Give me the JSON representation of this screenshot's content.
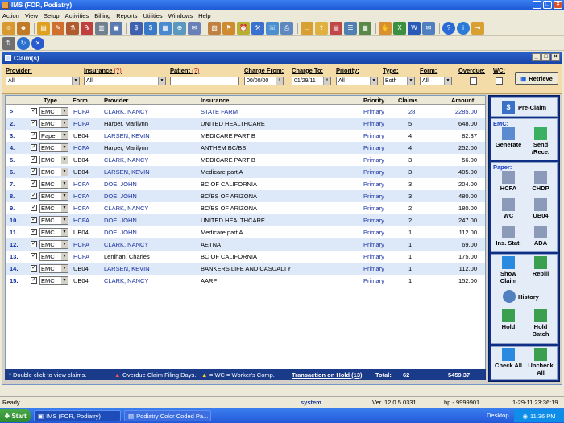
{
  "window": {
    "title": "IMS (FOR, Podiatry)"
  },
  "menu": [
    "Action",
    "View",
    "Setup",
    "Activities",
    "Billing",
    "Reports",
    "Utilities",
    "Windows",
    "Help"
  ],
  "child": {
    "title": "Claim(s)"
  },
  "filters": {
    "provider_label": "Provider:",
    "provider_value": "All",
    "insurance_label": "Insurance",
    "insurance_q": "(?)",
    "insurance_value": "All",
    "patient_label": "Patient",
    "patient_q": "(?)",
    "patient_value": "",
    "charge_from_label": "Charge From:",
    "charge_from_value": "00/00/00",
    "charge_to_label": "Charge To:",
    "charge_to_value": "01/29/11",
    "priority_label": "Priority:",
    "priority_value": "All",
    "type_label": "Type:",
    "type_value": "Both",
    "form_label": "Form:",
    "form_value": "All",
    "overdue_label": "Overdue:",
    "wc_label": "WC:",
    "retrieve_label": "Retrieve"
  },
  "grid": {
    "headers": {
      "type": "Type",
      "form": "Form",
      "provider": "Provider",
      "insurance": "Insurance",
      "priority": "Priority",
      "claims": "Claims",
      "amount": "Amount"
    },
    "rows": [
      {
        "num": ">",
        "type": "EMC",
        "form": "HCFA",
        "provider": "CLARK, NANCY",
        "insurance": "STATE FARM",
        "priority": "Primary",
        "claims": "28",
        "amount": "2285.00"
      },
      {
        "num": "2.",
        "type": "EMC",
        "form": "HCFA",
        "provider": "Harper, Marilynn",
        "insurance": "UNITED HEALTHCARE",
        "priority": "Primary",
        "claims": "5",
        "amount": "648.00"
      },
      {
        "num": "3.",
        "type": "Paper",
        "form": "UB04",
        "provider": "LARSEN, KEVIN",
        "insurance": "MEDICARE PART B",
        "priority": "Primary",
        "claims": "4",
        "amount": "82.37"
      },
      {
        "num": "4.",
        "type": "EMC",
        "form": "HCFA",
        "provider": "Harper, Marilynn",
        "insurance": "ANTHEM BC/BS",
        "priority": "Primary",
        "claims": "4",
        "amount": "252.00"
      },
      {
        "num": "5.",
        "type": "EMC",
        "form": "UB04",
        "provider": "CLARK, NANCY",
        "insurance": "MEDICARE PART B",
        "priority": "Primary",
        "claims": "3",
        "amount": "56.00"
      },
      {
        "num": "6.",
        "type": "EMC",
        "form": "UB04",
        "provider": "LARSEN, KEVIN",
        "insurance": "Medicare part A",
        "priority": "Primary",
        "claims": "3",
        "amount": "405.00"
      },
      {
        "num": "7.",
        "type": "EMC",
        "form": "HCFA",
        "provider": "DOE, JOHN",
        "insurance": "BC OF CALIFORNIA",
        "priority": "Primary",
        "claims": "3",
        "amount": "204.00"
      },
      {
        "num": "8.",
        "type": "EMC",
        "form": "HCFA",
        "provider": "DOE, JOHN",
        "insurance": "BC/BS OF ARIZONA",
        "priority": "Primary",
        "claims": "3",
        "amount": "480.00"
      },
      {
        "num": "9.",
        "type": "EMC",
        "form": "HCFA",
        "provider": "CLARK, NANCY",
        "insurance": "BC/BS OF ARIZONA",
        "priority": "Primary",
        "claims": "2",
        "amount": "180.00"
      },
      {
        "num": "10.",
        "type": "EMC",
        "form": "HCFA",
        "provider": "DOE, JOHN",
        "insurance": "UNITED HEALTHCARE",
        "priority": "Primary",
        "claims": "2",
        "amount": "247.00"
      },
      {
        "num": "11.",
        "type": "EMC",
        "form": "UB04",
        "provider": "DOE, JOHN",
        "insurance": "Medicare part A",
        "priority": "Primary",
        "claims": "1",
        "amount": "112.00"
      },
      {
        "num": "12.",
        "type": "EMC",
        "form": "HCFA",
        "provider": "CLARK, NANCY",
        "insurance": "AETNA",
        "priority": "Primary",
        "claims": "1",
        "amount": "69.00"
      },
      {
        "num": "13.",
        "type": "EMC",
        "form": "HCFA",
        "provider": "Lenihan, Charles",
        "insurance": "BC OF CALIFORNIA",
        "priority": "Primary",
        "claims": "1",
        "amount": "175.00"
      },
      {
        "num": "14.",
        "type": "EMC",
        "form": "UB04",
        "provider": "LARSEN, KEVIN",
        "insurance": "BANKERS LIFE AND CASUALTY",
        "priority": "Primary",
        "claims": "1",
        "amount": "112.00"
      },
      {
        "num": "15.",
        "type": "EMC",
        "form": "UB04",
        "provider": "CLARK, NANCY",
        "insurance": "AARP",
        "priority": "Primary",
        "claims": "1",
        "amount": "152.00"
      }
    ]
  },
  "footer": {
    "hint": "* Double click  to view claims.",
    "overdue": "Overdue Claim Filing Days.",
    "wc": "= WC = Worker's Comp.",
    "hold": "Transaction on Hold (13)",
    "total_label": "Total:",
    "total_claims": "62",
    "total_amount": "5459.37"
  },
  "side": {
    "preclaim": "Pre-Claim",
    "emc_label": "EMC:",
    "generate": "Generate",
    "send": "Send /Rece.",
    "paper_label": "Paper:",
    "hcfa": "HCFA",
    "chdp": "CHDP",
    "wc": "WC",
    "ub04": "UB04",
    "insstat": "Ins. Stat.",
    "ada": "ADA",
    "showclaim": "Show Claim",
    "rebill": "Rebill",
    "history": "History",
    "hold": "Hold",
    "holdbatch": "Hold Batch",
    "checkall": "Check All",
    "uncheckall": "Uncheck All"
  },
  "status": {
    "ready": "Ready",
    "user": "system",
    "ver": "Ver. 12.0.5.0331",
    "hp": "hp - 9999901",
    "datetime": "1-29-11  23:36:19"
  },
  "taskbar": {
    "start": "Start",
    "task1": "IMS (FOR, Podiatry)",
    "task2": "Podiatry Color Coded Pa...",
    "desktop": "Desktop",
    "clock": "11:36 PM"
  }
}
